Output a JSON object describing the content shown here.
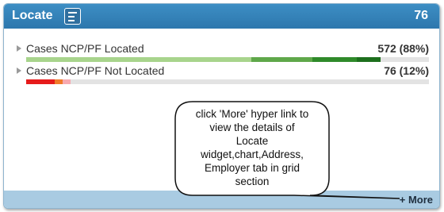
{
  "widget": {
    "title": "Locate",
    "count": "76",
    "menu_icon": "list-icon",
    "accent": "#2f7db6"
  },
  "rows": [
    {
      "label": "Cases NCP/PF Located",
      "value": "572 (88%)",
      "segments": [
        {
          "color": "#a8d48c",
          "fraction": 0.56
        },
        {
          "color": "#5fa84a",
          "fraction": 0.15
        },
        {
          "color": "#2f8a2a",
          "fraction": 0.11
        },
        {
          "color": "#1d6f1d",
          "fraction": 0.06
        }
      ]
    },
    {
      "label": "Cases NCP/PF Not Located",
      "value": "76 (12%)",
      "segments": [
        {
          "color": "#e61b1b",
          "fraction": 0.07
        },
        {
          "color": "#f07b2a",
          "fraction": 0.02
        },
        {
          "color": "#f7a9b0",
          "fraction": 0.02
        }
      ]
    }
  ],
  "footer": {
    "more_label": "+ More"
  },
  "callout": {
    "lines": [
      "click 'More' hyper link to",
      "view the details of",
      "Locate",
      "widget,chart,Address,",
      "Employer tab in grid",
      "section"
    ]
  }
}
